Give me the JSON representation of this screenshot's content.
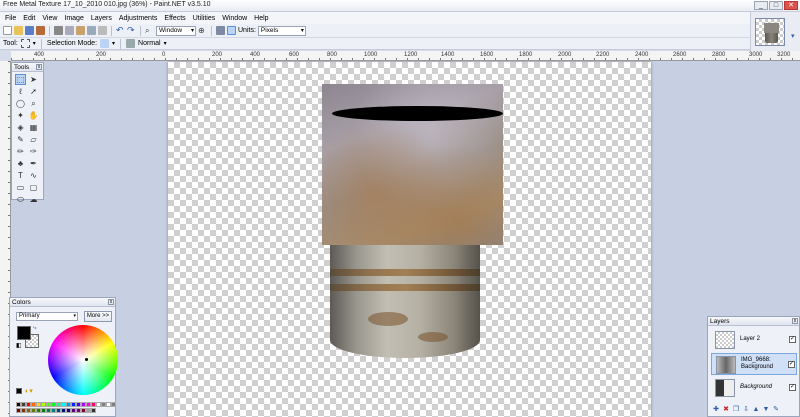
{
  "window": {
    "title": "Free Metal Texture 17_10_2010 010.jpg (36%) - Paint.NET v3.5.10",
    "min": "_",
    "max": "□",
    "close": "✕"
  },
  "menu": [
    "File",
    "Edit",
    "View",
    "Image",
    "Layers",
    "Adjustments",
    "Effects",
    "Utilities",
    "Window",
    "Help"
  ],
  "toolbar": {
    "zoom_value": "Window",
    "units_label": "Units:",
    "units_value": "Pixels"
  },
  "toolbar2": {
    "tool_label": "Tool:",
    "selection_mode_label": "Selection Mode:",
    "blend_value": "Normal"
  },
  "ruler": {
    "marks": [
      "400",
      "200",
      "0",
      "200",
      "400",
      "600",
      "800",
      "1000",
      "1200",
      "1400",
      "1600",
      "1800",
      "2000",
      "2200",
      "2400",
      "2600",
      "2800",
      "3000",
      "3200"
    ]
  },
  "tools_panel": {
    "title": "Tools",
    "close": "x"
  },
  "colors_panel": {
    "title": "Colors",
    "close": "x",
    "mode": "Primary",
    "more_button": "More >>",
    "primary_color": "#000000"
  },
  "layers_panel": {
    "title": "Layers",
    "close": "x",
    "layers": [
      {
        "name": "Layer 2",
        "visible": "✓"
      },
      {
        "name": "IMG_9668: Background",
        "visible": "✓"
      },
      {
        "name": "Background",
        "visible": "✓"
      }
    ]
  }
}
